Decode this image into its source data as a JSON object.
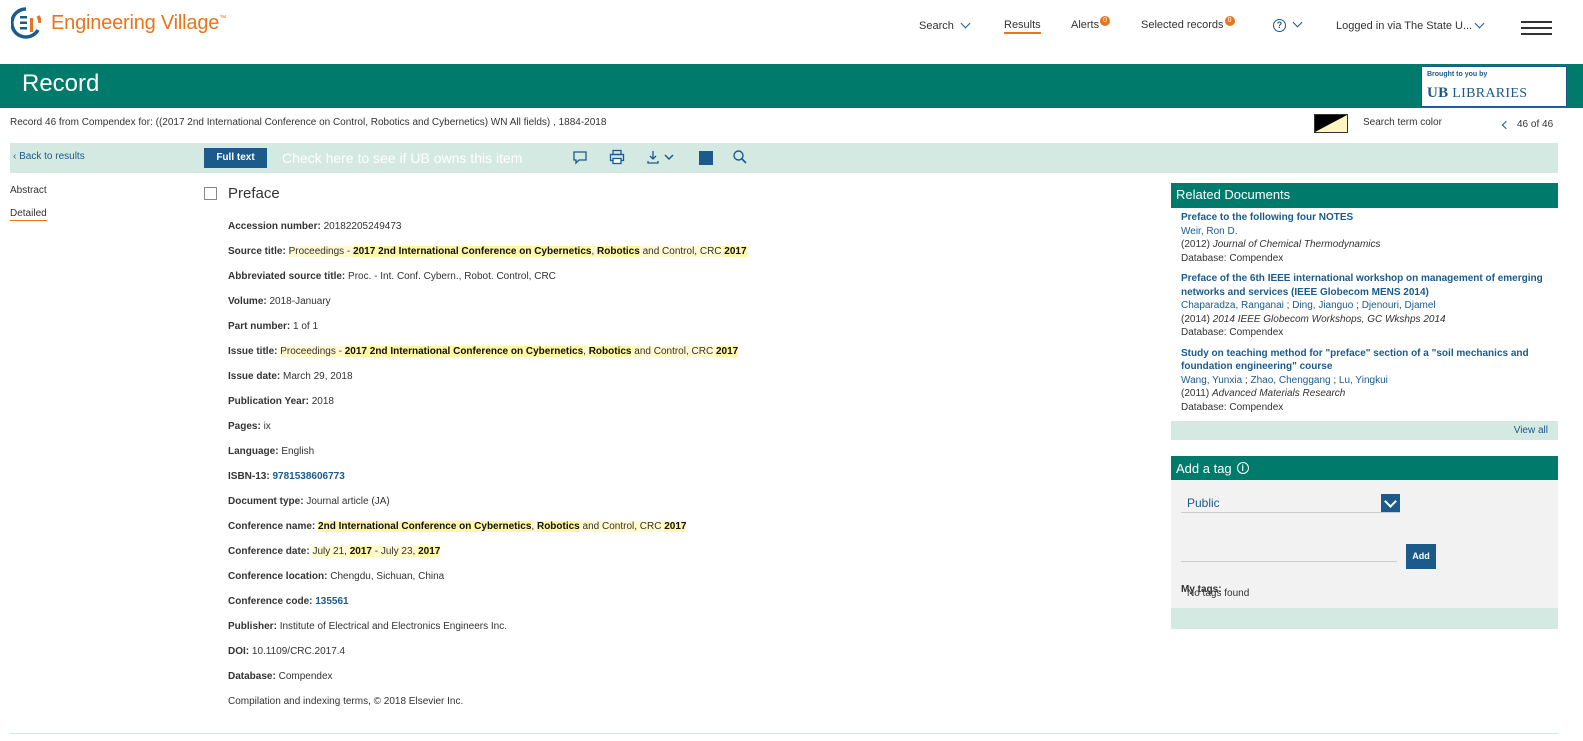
{
  "app": {
    "logo_text": "Engineering Village",
    "logo_tm": "™"
  },
  "topnav": {
    "search": "Search",
    "results": "Results",
    "alerts": "Alerts",
    "alerts_count": "0",
    "selected_records": "Selected records",
    "selected_count": "0",
    "help_icon": "?",
    "logged_in": "Logged in via The State U..."
  },
  "banner": {
    "title": "Record",
    "brought_by": "Brought to you by",
    "ub_mark": "UB",
    "libraries": "LIBRARIES"
  },
  "record_line": "Record 46 from Compendex for: ((2017 2nd International Conference on Control, Robotics and Cybernetics) WN All fields) , 1884-2018",
  "search_term_color": "Search term color",
  "pager": "46 of 46",
  "toolbar": {
    "back": "Back to results",
    "full_text": "Full text",
    "check_ub": "Check here to see if UB owns this item"
  },
  "leftnav": {
    "abstract": "Abstract",
    "detailed": "Detailed"
  },
  "record": {
    "title": "Preface",
    "fields": {
      "accession_label": "Accession number:",
      "accession_value": "20182205249473",
      "source_label": "Source title:",
      "source_pre": "Proceedings - ",
      "source_h1": "2017 2nd International Conference on Cybernetics",
      "source_sep": ", ",
      "source_h2": "Robotics",
      "source_mid": " and Control, CRC ",
      "source_h3": "2017",
      "abbrev_label": "Abbreviated source title:",
      "abbrev_value": "Proc. - Int. Conf. Cybern., Robot. Control, CRC",
      "volume_label": "Volume:",
      "volume_value": "2018-January",
      "part_label": "Part number:",
      "part_value": "1 of 1",
      "issue_title_label": "Issue title:",
      "issue_pre": "Proceedings - ",
      "issue_h1": "2017 2nd International Conference on Cybernetics",
      "issue_sep": ", ",
      "issue_h2": "Robotics",
      "issue_mid": " and Control, CRC ",
      "issue_h3": "2017",
      "issue_date_label": "Issue date:",
      "issue_date_value": "March 29, 2018",
      "pub_year_label": "Publication Year:",
      "pub_year_value": "2018",
      "pages_label": "Pages:",
      "pages_value": "ix",
      "language_label": "Language:",
      "language_value": "English",
      "isbn_label": "ISBN-13:",
      "isbn_value": "9781538606773",
      "doctype_label": "Document type:",
      "doctype_value": "Journal article (JA)",
      "conf_name_label": "Conference name:",
      "conf_h1": "2nd International Conference on Cybernetics",
      "conf_sep": ", ",
      "conf_h2": "Robotics",
      "conf_mid": " and Control, CRC ",
      "conf_h3": "2017",
      "conf_date_label": "Conference date:",
      "conf_date_pre": "July 21, ",
      "conf_date_h1": "2017",
      "conf_date_mid": " - July 23, ",
      "conf_date_h2": "2017",
      "conf_loc_label": "Conference location:",
      "conf_loc_value": "Chengdu, Sichuan, China",
      "conf_code_label": "Conference code:",
      "conf_code_value": "135561",
      "publisher_label": "Publisher:",
      "publisher_value": "Institute of Electrical and Electronics Engineers Inc.",
      "doi_label": "DOI:",
      "doi_value": "10.1109/CRC.2017.4",
      "database_label": "Database:",
      "database_value": "Compendex",
      "copyright": "Compilation and indexing terms, © 2018 Elsevier Inc."
    }
  },
  "related": {
    "heading": "Related Documents",
    "view_all": "View all",
    "items": [
      {
        "title": "Preface to the following four NOTES",
        "authors": [
          "Weir, Ron D."
        ],
        "year": "(2012)",
        "source": "Journal of Chemical Thermodynamics",
        "database": "Database: Compendex"
      },
      {
        "title": "Preface of the 6th IEEE international workshop on management of emerging networks and services (IEEE Globecom MENS 2014)",
        "authors": [
          "Chaparadza, Ranganai",
          "Ding, Jianguo",
          "Djenouri, Djamel"
        ],
        "year": "(2014)",
        "source": "2014 IEEE Globecom Workshops, GC Wkshps 2014",
        "database": "Database: Compendex"
      },
      {
        "title": "Study on teaching method for \"preface\" section of a \"soil mechanics and foundation engineering\" course",
        "authors": [
          "Wang, Yunxia",
          "Zhao, Chenggang",
          "Lu, Yingkui"
        ],
        "year": "(2011)",
        "source": "Advanced Materials Research",
        "database": "Database: Compendex"
      }
    ]
  },
  "tags": {
    "heading": "Add a tag",
    "info_icon": "i",
    "visibility": "Public",
    "add": "Add",
    "my_tags": "My tags:",
    "no_tags": "No tags found"
  },
  "colors": {
    "brand_green": "#007b6b",
    "accent_orange": "#e8741b",
    "link_blue": "#1a5b8c",
    "highlight": "#fff6a8"
  }
}
